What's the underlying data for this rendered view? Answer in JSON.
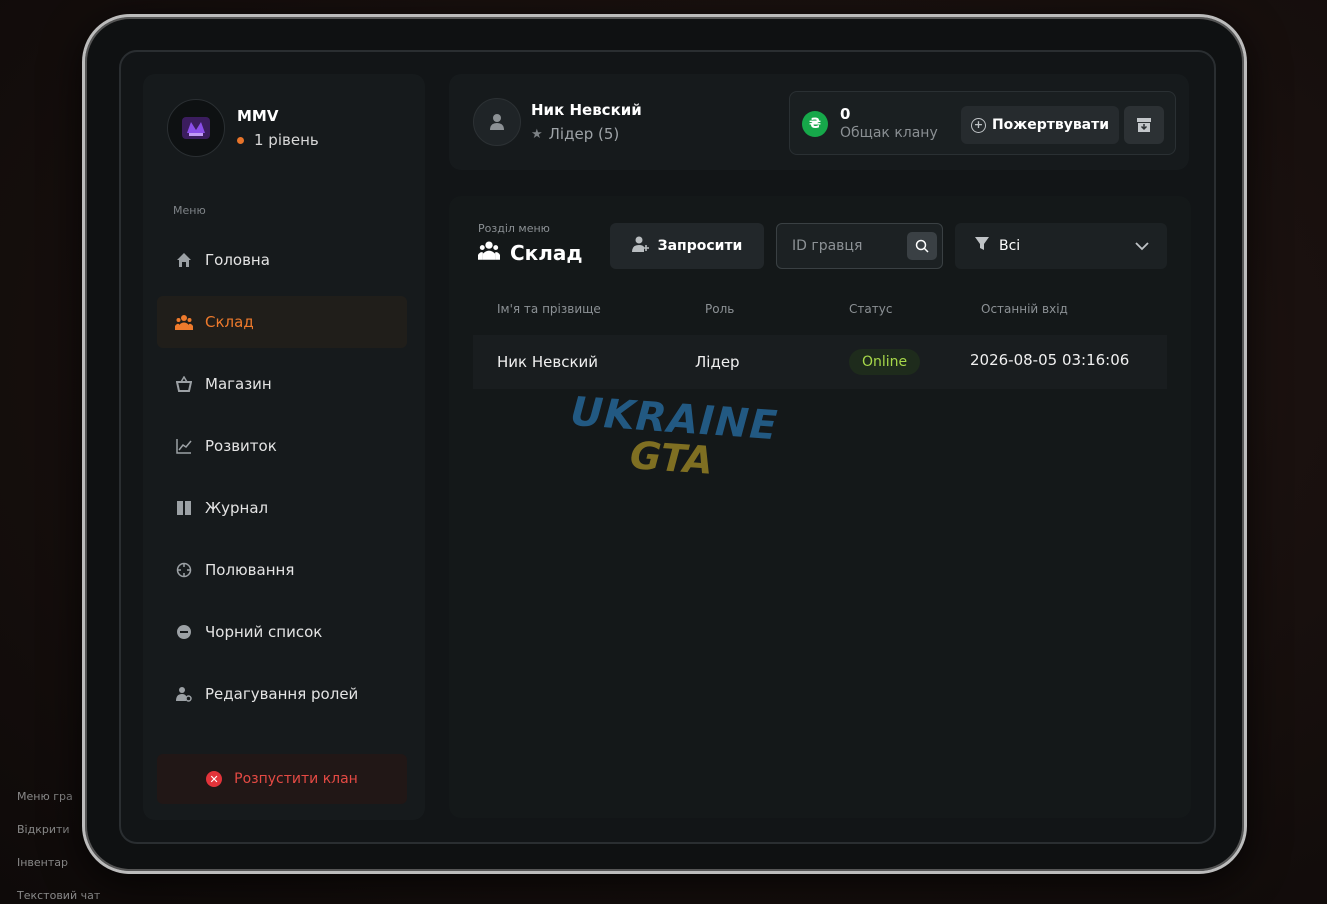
{
  "background_hud": {
    "items": [
      "Меню гра",
      "Відкрити",
      "Інвентар",
      "Текстовий чат"
    ]
  },
  "clan": {
    "name": "MMV",
    "level": "1 рівень",
    "logo_icon": "clan-logo-icon"
  },
  "sidebar": {
    "caption": "Меню",
    "items": [
      {
        "label": "Головна",
        "icon": "home-icon",
        "active": false
      },
      {
        "label": "Склад",
        "icon": "users-icon",
        "active": true
      },
      {
        "label": "Магазин",
        "icon": "basket-icon",
        "active": false
      },
      {
        "label": "Розвиток",
        "icon": "chart-icon",
        "active": false
      },
      {
        "label": "Журнал",
        "icon": "book-icon",
        "active": false
      },
      {
        "label": "Полювання",
        "icon": "crosshair-icon",
        "active": false
      },
      {
        "label": "Чорний список",
        "icon": "minus-circle-icon",
        "active": false
      },
      {
        "label": "Редагування ролей",
        "icon": "user-gear-icon",
        "active": false
      }
    ],
    "disband_label": "Розпустити клан"
  },
  "user": {
    "name": "Ник Невский",
    "role": "Лідер (5)"
  },
  "bank": {
    "amount": "0",
    "label": "Общак клану",
    "donate_label": "Пожертвувати",
    "currency_symbol": "₴"
  },
  "main": {
    "section_caption": "Розділ меню",
    "section_title": "Склад",
    "invite_label": "Запросити",
    "search_placeholder": "ID гравця",
    "filter_value": "Всі",
    "columns": {
      "name": "Ім'я та прізвище",
      "role": "Роль",
      "status": "Статус",
      "last_login": "Останній вхід"
    },
    "rows": [
      {
        "name": "Ник Невский",
        "role": "Лідер",
        "status": "Online",
        "last_login": "2026-08-05 03:16:06"
      }
    ]
  },
  "watermark": {
    "line1": "UKRAINE",
    "line2": "GTA"
  },
  "colors": {
    "accent": "#ee7a2c",
    "online": "#a7d84a",
    "danger": "#e44a44",
    "coin": "#16a84a"
  }
}
